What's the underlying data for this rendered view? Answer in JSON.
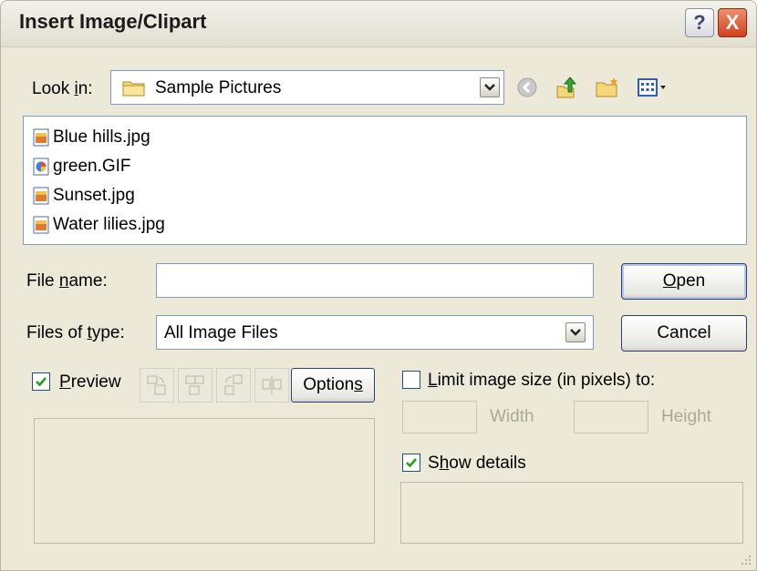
{
  "window": {
    "title": "Insert Image/Clipart",
    "help": "?",
    "close": "X"
  },
  "look_in": {
    "label_pre": "Look ",
    "label_key": "i",
    "label_post": "n:",
    "value": "Sample Pictures"
  },
  "toolbar_icons": [
    "back-icon",
    "up-folder-icon",
    "new-folder-icon",
    "view-menu-icon"
  ],
  "files": [
    {
      "name": "Blue hills.jpg",
      "icon": "jpg-file-icon"
    },
    {
      "name": "green.GIF",
      "icon": "gif-file-icon"
    },
    {
      "name": "Sunset.jpg",
      "icon": "jpg-file-icon"
    },
    {
      "name": "Water lilies.jpg",
      "icon": "jpg-file-icon"
    }
  ],
  "file_name": {
    "label_pre": "File ",
    "label_key": "n",
    "label_post": "ame:",
    "value": ""
  },
  "file_type": {
    "label_pre": "Files of ",
    "label_key": "t",
    "label_post": "ype:",
    "value": "All Image Files"
  },
  "buttons": {
    "open_key": "O",
    "open_rest": "pen",
    "cancel": "Cancel",
    "options_pre": "Option",
    "options_key": "s"
  },
  "preview": {
    "label_key": "P",
    "label_rest": "review",
    "checked": true
  },
  "limit": {
    "label_key": "L",
    "label_rest": "imit image size (in pixels) to:",
    "checked": false,
    "width_label": "Width",
    "height_label": "Height"
  },
  "show_details": {
    "label_pre": "S",
    "label_key": "h",
    "label_post": "ow details",
    "checked": true
  },
  "colors": {
    "dialog_bg": "#ece9d8",
    "field_border": "#7f9db9",
    "checkmark": "#21a121",
    "close_red": "#d1411f"
  }
}
